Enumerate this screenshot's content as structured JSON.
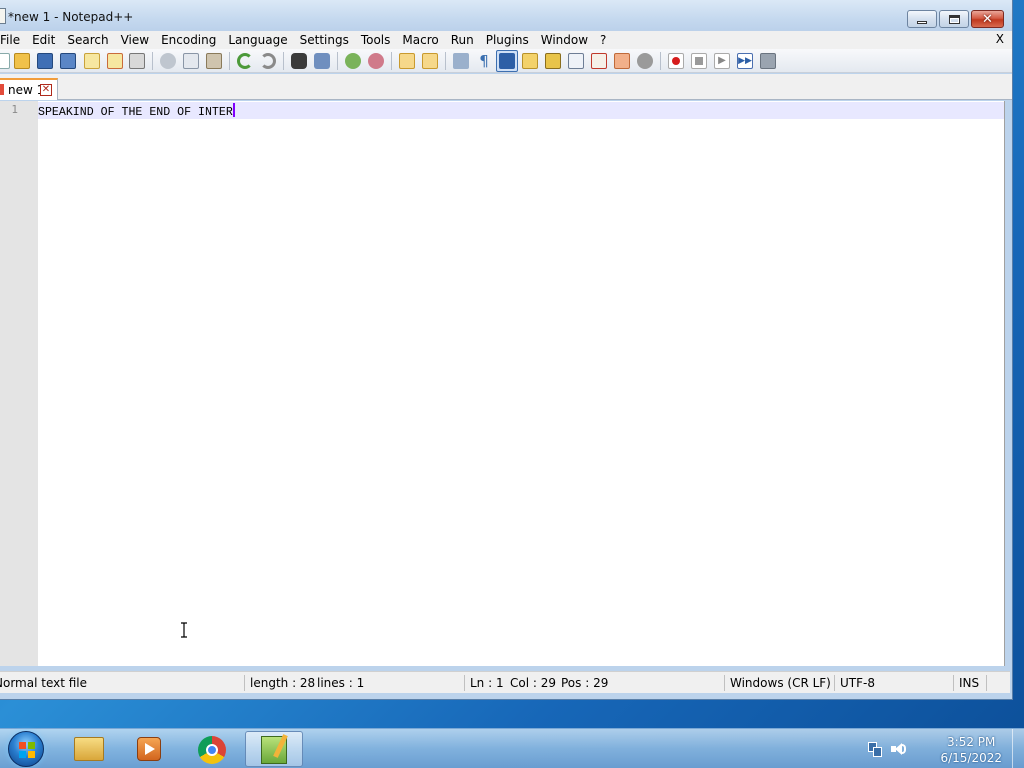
{
  "window": {
    "title": "*new 1 - Notepad++"
  },
  "menu": {
    "items": [
      "File",
      "Edit",
      "Search",
      "View",
      "Encoding",
      "Language",
      "Settings",
      "Tools",
      "Macro",
      "Run",
      "Plugins",
      "Window",
      "?"
    ],
    "close_label": "X"
  },
  "toolbar": {
    "icons": [
      "new-file-icon",
      "open-file-icon",
      "save-icon",
      "save-all-icon",
      "close-icon",
      "close-all-icon",
      "print-icon",
      "cut-icon",
      "copy-icon",
      "paste-icon",
      "undo-icon",
      "redo-icon",
      "find-icon",
      "replace-icon",
      "zoom-in-icon",
      "zoom-out-icon",
      "sync-vertical-icon",
      "sync-horizontal-icon",
      "word-wrap-icon",
      "show-all-characters-icon",
      "indent-guide-icon",
      "user-language-icon",
      "document-map-icon",
      "function-list-icon",
      "folder-as-workspace-icon",
      "monitoring-icon",
      "record-macro-icon",
      "stop-recording-icon",
      "play-macro-icon",
      "run-macro-multiple-icon",
      "save-macro-icon"
    ]
  },
  "tab": {
    "label": "new 1"
  },
  "editor": {
    "line_number": "1",
    "text": "SPEAKIND OF THE END OF INTER"
  },
  "status": {
    "file_type": "Normal text file",
    "length": "length : 28",
    "lines": "lines : 1",
    "ln": "Ln : 1",
    "col": "Col : 29",
    "pos": "Pos : 29",
    "eol": "Windows (CR LF)",
    "encoding": "UTF-8",
    "mode": "INS"
  },
  "taskbar": {
    "apps": [
      "windows-explorer-icon",
      "media-player-icon",
      "chrome-icon",
      "notepad-plus-plus-icon"
    ],
    "time": "3:52 PM",
    "date": "6/15/2022"
  },
  "colors": {
    "current_line": "#e8e8ff",
    "caret": "#8000ff",
    "tab_accent": "#f29d3a",
    "close_button": "#c0391f"
  }
}
